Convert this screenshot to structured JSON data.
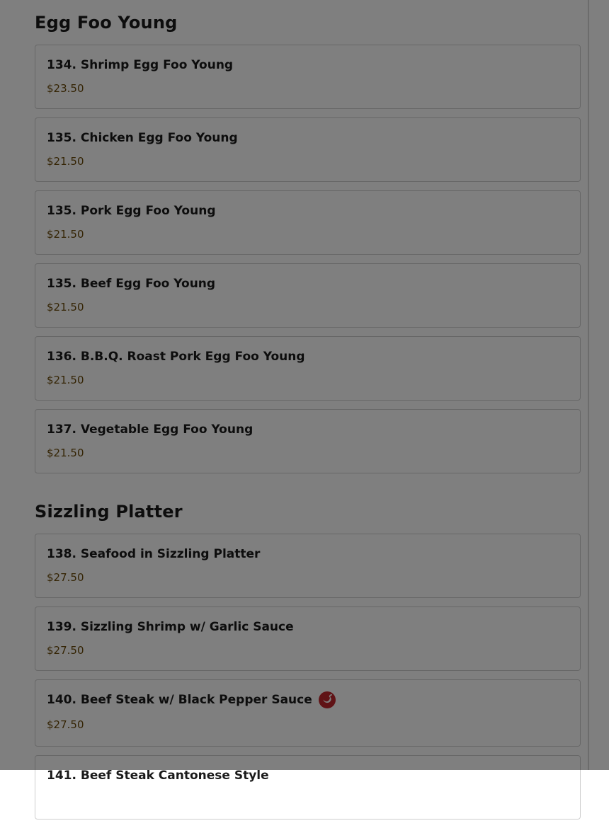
{
  "sections": [
    {
      "title": "Egg Foo Young",
      "items": [
        {
          "name": "134. Shrimp Egg Foo Young",
          "price": "$23.50"
        },
        {
          "name": "135. Chicken Egg Foo Young",
          "price": "$21.50"
        },
        {
          "name": "135. Pork Egg Foo Young",
          "price": "$21.50"
        },
        {
          "name": "135. Beef Egg Foo Young",
          "price": "$21.50"
        },
        {
          "name": "136. B.B.Q. Roast Pork Egg Foo Young",
          "price": "$21.50"
        },
        {
          "name": "137. Vegetable Egg Foo Young",
          "price": "$21.50"
        }
      ]
    },
    {
      "title": "Sizzling Platter",
      "items": [
        {
          "name": "138. Seafood in Sizzling Platter",
          "price": "$27.50"
        },
        {
          "name": "139. Sizzling Shrimp w/ Garlic Sauce",
          "price": "$27.50"
        },
        {
          "name": "140. Beef Steak w/ Black Pepper Sauce",
          "price": "$27.50",
          "icon": "spicy-pepper-icon"
        },
        {
          "name": "141. Beef Steak Cantonese Style",
          "price": ""
        }
      ]
    }
  ],
  "colors": {
    "overlay": "rgba(0,0,0,0.5)",
    "price": "#6b4a0a",
    "spicy_icon": "#c0272d"
  }
}
